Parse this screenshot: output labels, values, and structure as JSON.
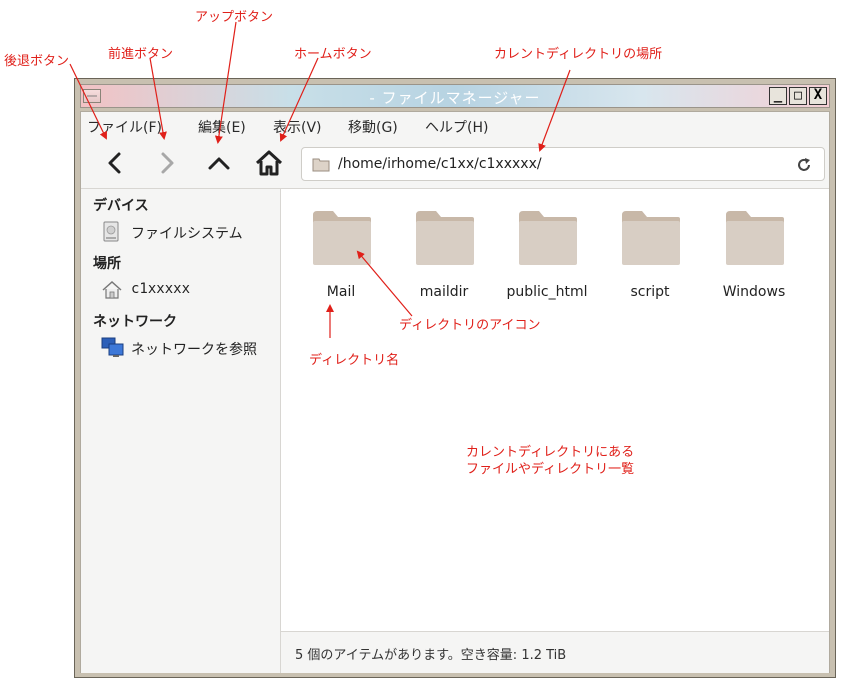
{
  "window": {
    "title": "- ファイルマネージャー",
    "controls": {
      "minimize": "_",
      "maximize": "□",
      "close": "X"
    }
  },
  "menubar": [
    "ファイル(F)",
    "編集(E)",
    "表示(V)",
    "移動(G)",
    "ヘルプ(H)"
  ],
  "toolbar": {
    "back_icon": "chevron-left-icon",
    "forward_icon": "chevron-right-icon",
    "up_icon": "chevron-up-icon",
    "home_icon": "home-icon",
    "location": "/home/irhome/c1xx/c1xxxxx/",
    "reload_icon": "reload-icon"
  },
  "sidebar": {
    "sections": [
      {
        "heading": "デバイス",
        "items": [
          {
            "label": "ファイルシステム",
            "icon": "drive-icon"
          }
        ]
      },
      {
        "heading": "場所",
        "items": [
          {
            "label": "c1xxxxx",
            "icon": "home-folder-icon"
          }
        ]
      },
      {
        "heading": "ネットワーク",
        "items": [
          {
            "label": "ネットワークを参照",
            "icon": "network-icon"
          }
        ]
      }
    ]
  },
  "files": [
    "Mail",
    "maildir",
    "public_html",
    "script",
    "Windows"
  ],
  "status": "5 個のアイテムがあります。空き容量: 1.2 TiB",
  "annotations": {
    "back": "後退ボタン",
    "forward": "前進ボタン",
    "up": "アップボタン",
    "home": "ホームボタン",
    "location": "カレントディレクトリの場所",
    "icon": "ディレクトリのアイコン",
    "name": "ディレクトリ名",
    "list_line1": "カレントディレクトリにある",
    "list_line2": "ファイルやディレクトリ一覧"
  },
  "colors": {
    "annotation": "#e0201a",
    "folder": "#d8cec4",
    "folder_tab": "#c8b8a8"
  }
}
